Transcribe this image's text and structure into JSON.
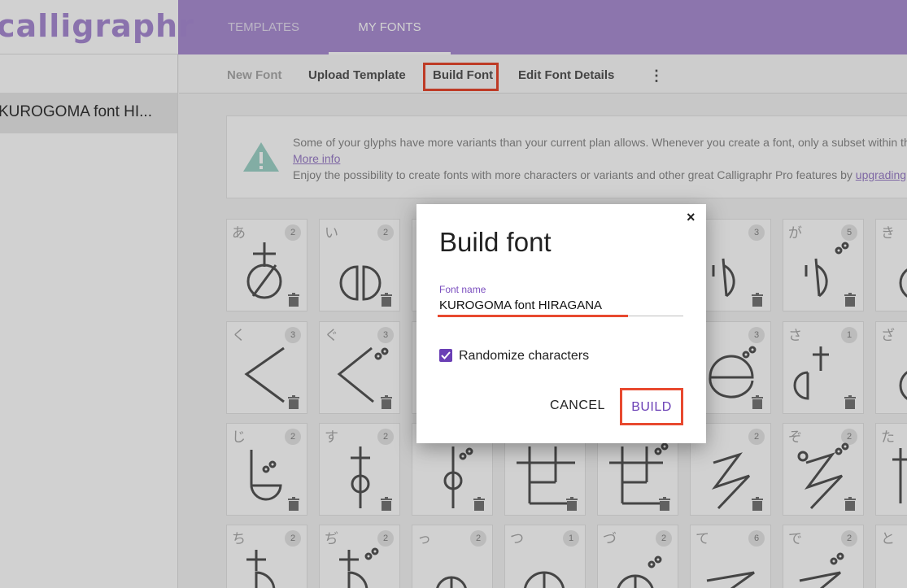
{
  "app": {
    "logo_text": "calligraphr"
  },
  "tabs": [
    {
      "label": "TEMPLATES"
    },
    {
      "label": "MY FONTS"
    }
  ],
  "sidebar": {
    "items": [
      {
        "label": "KUROGOMA font HI..."
      }
    ]
  },
  "toolbar": {
    "new_font": "New Font",
    "upload_template": "Upload Template",
    "build_font": "Build Font",
    "edit_font_details": "Edit Font Details",
    "more_icon": "more-vertical-icon"
  },
  "notice": {
    "line1": "Some of your glyphs have more variants than your current plan allows. Whenever you create a font, only a subset within thi",
    "link": "More info",
    "line3_prefix": "Enjoy the possibility to create fonts with more characters or variants and other great Calligraphr Pro features by ",
    "line3_link": "upgrading"
  },
  "glyphs": [
    {
      "char": "あ",
      "count": "2"
    },
    {
      "char": "い",
      "count": "2"
    },
    {
      "char": "",
      "count": "3"
    },
    {
      "char": "が",
      "count": "5"
    },
    {
      "char": "き",
      "count": ""
    },
    {
      "char": "く",
      "count": "3"
    },
    {
      "char": "ぐ",
      "count": "3"
    },
    {
      "char": "",
      "count": "3"
    },
    {
      "char": "さ",
      "count": "1"
    },
    {
      "char": "ざ",
      "count": ""
    },
    {
      "char": "じ",
      "count": "2"
    },
    {
      "char": "す",
      "count": "2"
    },
    {
      "char": "",
      "count": "2"
    },
    {
      "char": "ぞ",
      "count": "2"
    },
    {
      "char": "た",
      "count": ""
    },
    {
      "char": "ち",
      "count": "2"
    },
    {
      "char": "ぢ",
      "count": "2"
    },
    {
      "char": "っ",
      "count": "2"
    },
    {
      "char": "つ",
      "count": "1"
    },
    {
      "char": "づ",
      "count": "2"
    },
    {
      "char": "て",
      "count": "6"
    },
    {
      "char": "で",
      "count": "2"
    },
    {
      "char": "と",
      "count": ""
    }
  ],
  "dialog": {
    "title": "Build font",
    "close_label": "×",
    "field_label": "Font name",
    "font_name": "KUROGOMA font HIRAGANA",
    "checkbox_label": "Randomize characters",
    "checkbox_checked": true,
    "cancel_label": "CANCEL",
    "build_label": "BUILD"
  },
  "colors": {
    "header": "#ab8fd3",
    "accent": "#6a3fb5",
    "highlight": "#e8492f"
  }
}
